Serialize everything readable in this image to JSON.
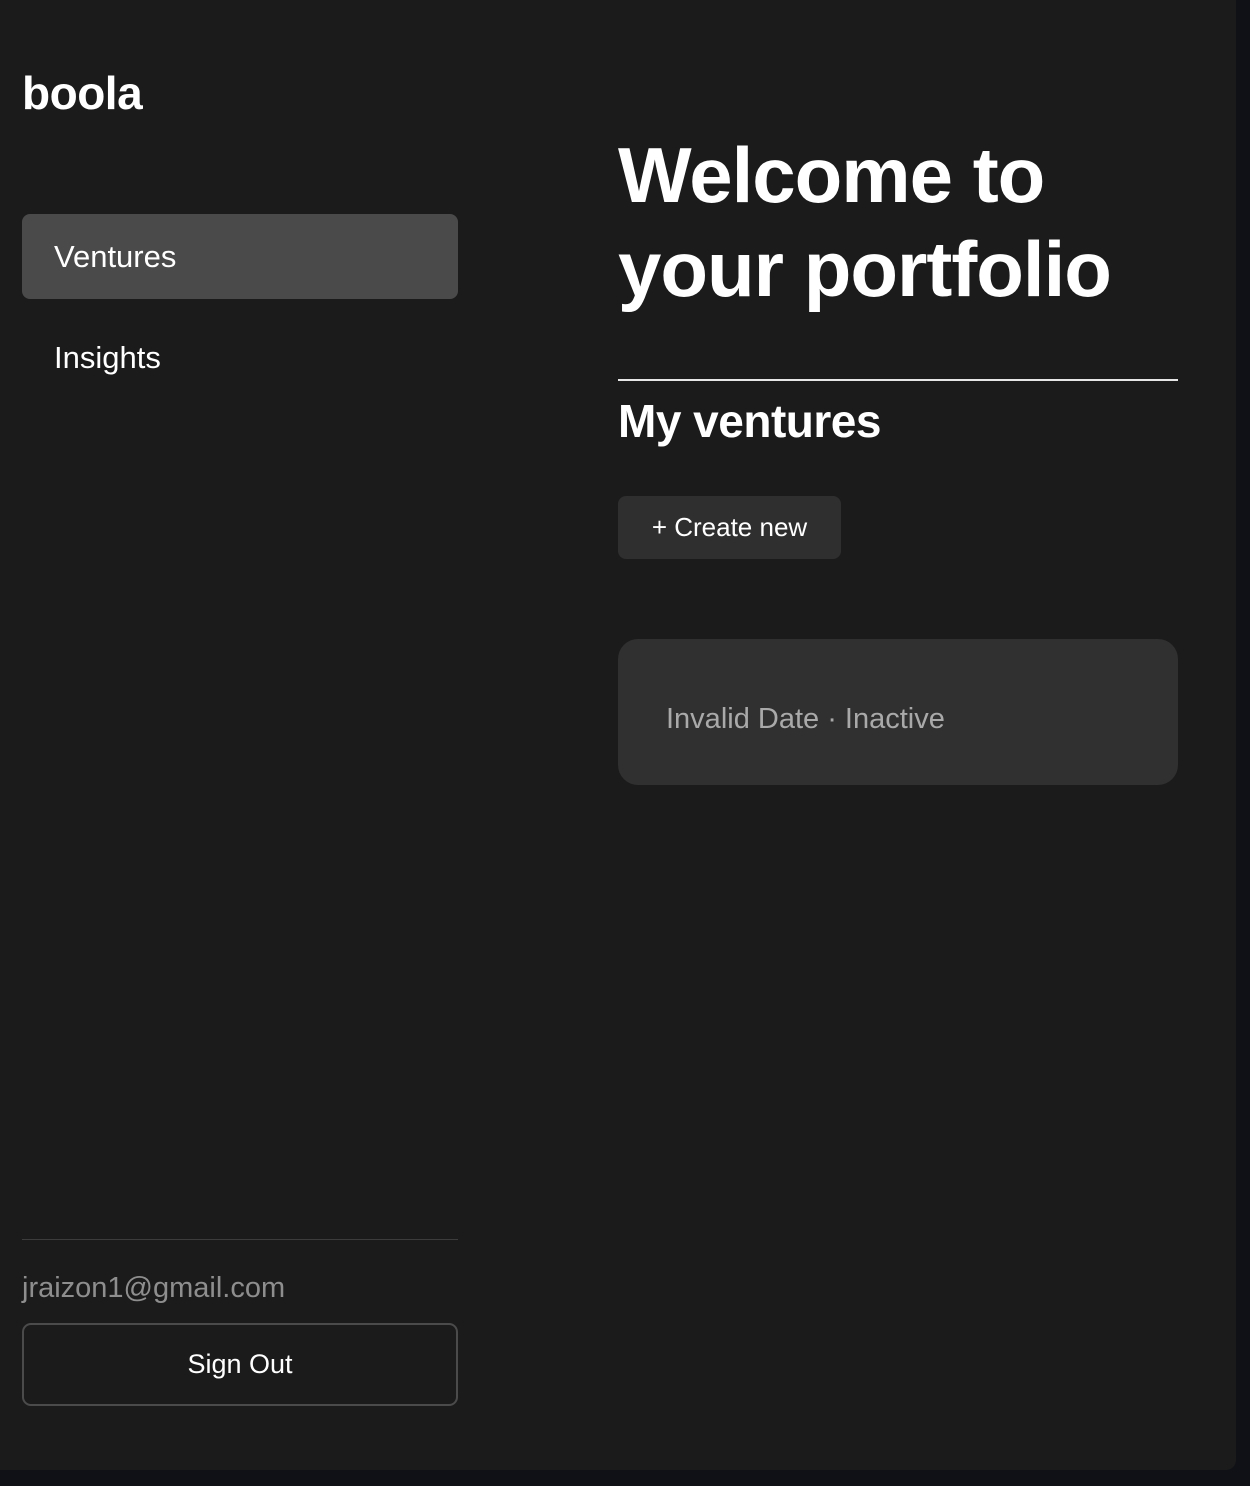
{
  "app": {
    "brand": "boola"
  },
  "sidebar": {
    "items": [
      {
        "label": "Ventures",
        "active": true
      },
      {
        "label": "Insights",
        "active": false
      }
    ],
    "user_email": "jraizon1@gmail.com",
    "signout_label": "Sign Out"
  },
  "main": {
    "welcome_title": "Welcome to your portfolio",
    "section_title": "My ventures",
    "create_label": "+ Create new",
    "ventures": [
      {
        "name": "",
        "meta": "Invalid Date · Inactive"
      }
    ]
  },
  "colors": {
    "background": "#1b1b1b",
    "active_nav": "#4a4a4a",
    "card": "#303030",
    "muted_text": "#a9a9a9"
  }
}
